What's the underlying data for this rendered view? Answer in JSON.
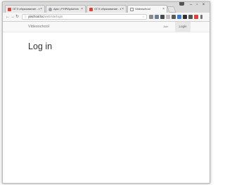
{
  "browser": {
    "tabs": [
      {
        "title": "ОГЭ образование - видео",
        "favicon": "red",
        "active": false
      },
      {
        "title": "Ajax | PHPMyAdmin",
        "favicon": "gray",
        "active": false
      },
      {
        "title": "ОГЭ образование - видео",
        "favicon": "red",
        "active": false
      },
      {
        "title": "Videoschool",
        "favicon": "doc",
        "active": true
      }
    ],
    "tab_close_glyph": "×",
    "window_controls": {
      "minimize": "–",
      "maximize": "▫",
      "close": "×"
    },
    "address": {
      "host": "yiischool.loc",
      "path": "/web/site/login"
    },
    "nav_icons": [
      "back-icon",
      "forward-icon",
      "reload-icon"
    ]
  },
  "site": {
    "brand": "Videoschool",
    "nav": {
      "join": "Join",
      "login": "Login"
    },
    "heading": "Log in"
  },
  "colors": {
    "navbar_bg": "#f8f8f8",
    "active_nav_bg": "#e7e7e7",
    "ext_icons": [
      "#8a8a8a",
      "#6b7f99",
      "#4a4a4a",
      "#bdbdbd",
      "#5a5a5a",
      "#3a7bd5",
      "#2f2f2f",
      "#555555",
      "#d9433b",
      "#707070"
    ]
  }
}
